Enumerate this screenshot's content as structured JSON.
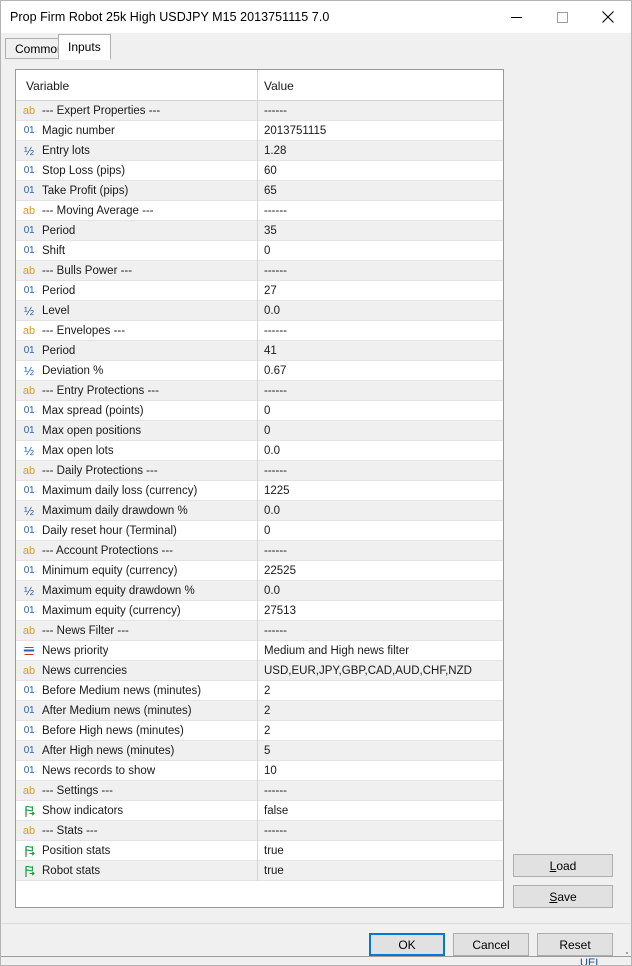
{
  "window": {
    "title": "Prop Firm Robot 25k High USDJPY M15 2013751115 7.0",
    "minimize_icon": "minimize-icon",
    "maximize_icon": "maximize-icon",
    "close_icon": "close-icon"
  },
  "tabs": [
    {
      "label": "Common",
      "active": false
    },
    {
      "label": "Inputs",
      "active": true
    }
  ],
  "grid": {
    "headers": {
      "variable": "Variable",
      "value": "Value"
    },
    "rows": [
      {
        "icon": "ab",
        "variable": "--- Expert Properties ---",
        "value": "------"
      },
      {
        "icon": "int",
        "variable": "Magic number",
        "value": "2013751115"
      },
      {
        "icon": "double",
        "variable": "Entry lots",
        "value": "1.28"
      },
      {
        "icon": "int",
        "variable": "Stop Loss   (pips)",
        "value": "60"
      },
      {
        "icon": "int",
        "variable": "Take Profit (pips)",
        "value": "65"
      },
      {
        "icon": "ab",
        "variable": "--- Moving Average ---",
        "value": "------"
      },
      {
        "icon": "int",
        "variable": "Period",
        "value": "35"
      },
      {
        "icon": "int",
        "variable": "Shift",
        "value": "0"
      },
      {
        "icon": "ab",
        "variable": "--- Bulls Power ---",
        "value": "------"
      },
      {
        "icon": "int",
        "variable": "Period",
        "value": "27"
      },
      {
        "icon": "double",
        "variable": "Level",
        "value": "0.0"
      },
      {
        "icon": "ab",
        "variable": "--- Envelopes ---",
        "value": "------"
      },
      {
        "icon": "int",
        "variable": "Period",
        "value": "41"
      },
      {
        "icon": "double",
        "variable": "Deviation %",
        "value": "0.67"
      },
      {
        "icon": "ab",
        "variable": "--- Entry Protections ---",
        "value": "------"
      },
      {
        "icon": "int",
        "variable": "Max spread (points)",
        "value": "0"
      },
      {
        "icon": "int",
        "variable": "Max open positions",
        "value": "0"
      },
      {
        "icon": "double",
        "variable": "Max open lots",
        "value": "0.0"
      },
      {
        "icon": "ab",
        "variable": "--- Daily Protections ---",
        "value": "------"
      },
      {
        "icon": "int",
        "variable": "Maximum daily loss (currency)",
        "value": "1225"
      },
      {
        "icon": "double",
        "variable": "Maximum daily drawdown %",
        "value": "0.0"
      },
      {
        "icon": "int",
        "variable": "Daily reset hour (Terminal)",
        "value": "0"
      },
      {
        "icon": "ab",
        "variable": "--- Account Protections ---",
        "value": "------"
      },
      {
        "icon": "int",
        "variable": "Minimum equity (currency)",
        "value": "22525"
      },
      {
        "icon": "double",
        "variable": "Maximum equity drawdown %",
        "value": "0.0"
      },
      {
        "icon": "int",
        "variable": "Maximum equity (currency)",
        "value": "27513"
      },
      {
        "icon": "ab",
        "variable": "--- News Filter ---",
        "value": "------"
      },
      {
        "icon": "enum",
        "variable": "News priority",
        "value": "Medium and High news filter"
      },
      {
        "icon": "ab",
        "variable": "News currencies",
        "value": "USD,EUR,JPY,GBP,CAD,AUD,CHF,NZD"
      },
      {
        "icon": "int",
        "variable": "Before Medium news (minutes)",
        "value": "2"
      },
      {
        "icon": "int",
        "variable": "After Medium news (minutes)",
        "value": "2"
      },
      {
        "icon": "int",
        "variable": "Before High news (minutes)",
        "value": "2"
      },
      {
        "icon": "int",
        "variable": "After High news (minutes)",
        "value": "5"
      },
      {
        "icon": "int",
        "variable": "News records to show",
        "value": "10"
      },
      {
        "icon": "ab",
        "variable": "--- Settings ---",
        "value": "------"
      },
      {
        "icon": "bool",
        "variable": "Show indicators",
        "value": "false"
      },
      {
        "icon": "ab",
        "variable": "--- Stats ---",
        "value": "------"
      },
      {
        "icon": "bool",
        "variable": "Position stats",
        "value": "true"
      },
      {
        "icon": "bool",
        "variable": "Robot stats",
        "value": "true"
      }
    ]
  },
  "side_buttons": [
    {
      "label": "Load",
      "accel": "L"
    },
    {
      "label": "Save",
      "accel": "S"
    }
  ],
  "bottom_buttons": [
    {
      "label": "OK",
      "default": true
    },
    {
      "label": "Cancel",
      "default": false
    },
    {
      "label": "Reset",
      "default": false
    }
  ],
  "footer": {
    "scrap_text": "UEI"
  },
  "colors": {
    "accent": "#0078d7",
    "icon_string": "#d99a29",
    "icon_numeric": "#2763b5",
    "icon_bool": "#1a9a3c",
    "icon_enum_red": "#c0392b",
    "row_alt": "#f0f0f0"
  }
}
